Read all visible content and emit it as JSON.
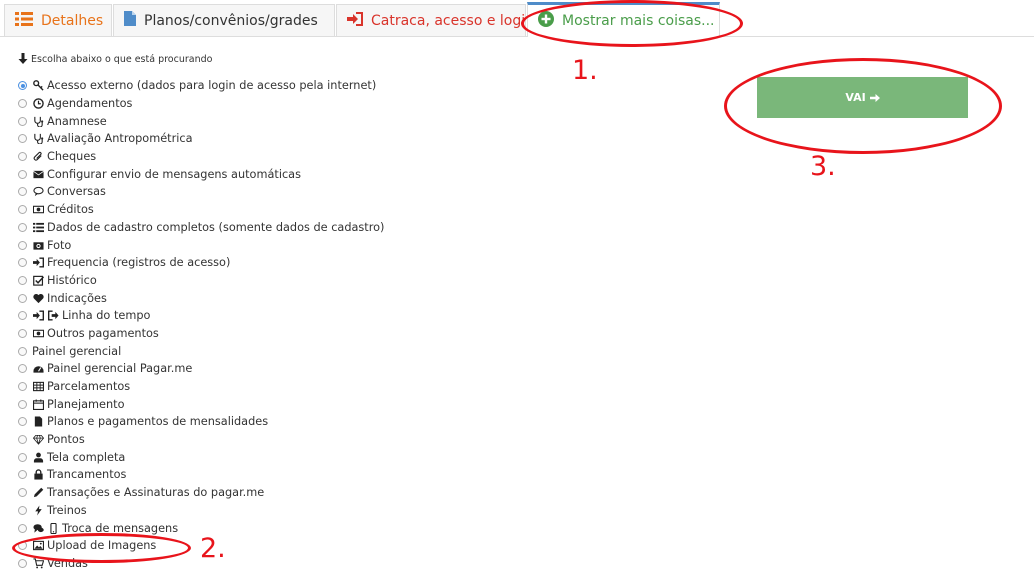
{
  "tabs": [
    {
      "label": "Detalhes",
      "icon": "list-icon",
      "color": "#e8731a"
    },
    {
      "label": "Planos/convênios/grades",
      "icon": "file-icon",
      "color": "#333333"
    },
    {
      "label": "Catraca, acesso e login",
      "icon": "sign-in-icon",
      "color": "#d9342b"
    },
    {
      "label": "Mostrar mais coisas...",
      "icon": "plus-circle-icon",
      "color": "#4a9d4a",
      "active": true
    }
  ],
  "caption": "Escolha abaixo o que está procurando",
  "options": [
    {
      "label": "Acesso externo (dados para login de acesso pela internet)",
      "icon": "key-icon",
      "selected": true
    },
    {
      "label": "Agendamentos",
      "icon": "clock-icon"
    },
    {
      "label": "Anamnese",
      "icon": "stethoscope-icon"
    },
    {
      "label": "Avaliação Antropométrica",
      "icon": "stethoscope-icon"
    },
    {
      "label": "Cheques",
      "icon": "paperclip-icon"
    },
    {
      "label": "Configurar envio de mensagens automáticas",
      "icon": "envelope-icon"
    },
    {
      "label": "Conversas",
      "icon": "comments-icon"
    },
    {
      "label": "Créditos",
      "icon": "money-icon"
    },
    {
      "label": "Dados de cadastro completos (somente dados de cadastro)",
      "icon": "list-icon"
    },
    {
      "label": "Foto",
      "icon": "camera-icon"
    },
    {
      "label": "Frequencia (registros de acesso)",
      "icon": "sign-in-icon"
    },
    {
      "label": "Histórico",
      "icon": "check-square-icon"
    },
    {
      "label": "Indicações",
      "icon": "heart-icon"
    },
    {
      "label": "Linha do tempo",
      "icon": "sign-in-out-icon"
    },
    {
      "label": "Outros pagamentos",
      "icon": "money-icon"
    },
    {
      "label": "Painel gerencial",
      "icon": ""
    },
    {
      "label": "Painel gerencial Pagar.me",
      "icon": "dashboard-icon"
    },
    {
      "label": "Parcelamentos",
      "icon": "table-icon"
    },
    {
      "label": "Planejamento",
      "icon": "calendar-icon"
    },
    {
      "label": "Planos e pagamentos de mensalidades",
      "icon": "file-icon"
    },
    {
      "label": "Pontos",
      "icon": "diamond-icon"
    },
    {
      "label": "Tela completa",
      "icon": "user-icon"
    },
    {
      "label": "Trancamentos",
      "icon": "lock-icon"
    },
    {
      "label": "Transações e Assinaturas do pagar.me",
      "icon": "pencil-icon"
    },
    {
      "label": "Treinos",
      "icon": "bolt-icon"
    },
    {
      "label": "Troca de mensagens",
      "icon": "comments-mobile-icon"
    },
    {
      "label": "Upload de Imagens",
      "icon": "picture-icon"
    },
    {
      "label": "Vendas",
      "icon": "cart-icon"
    }
  ],
  "go_button": {
    "label": "VAI",
    "color": "#7ab77a"
  },
  "annotations": [
    {
      "number": "1.",
      "target": "tab-mostrar-mais"
    },
    {
      "number": "2.",
      "target": "option-upload-de-imagens"
    },
    {
      "number": "3.",
      "target": "go-button"
    }
  ],
  "annotation_color": "#e8141b"
}
